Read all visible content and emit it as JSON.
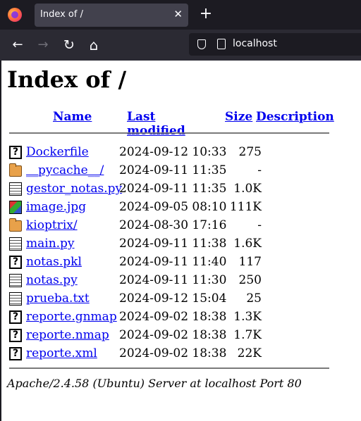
{
  "browser": {
    "tab_title": "Index of /",
    "tab_close": "✕",
    "new_tab": "+",
    "url": "localhost",
    "back": "←",
    "forward": "→",
    "reload": "↻",
    "home": "⌂"
  },
  "page": {
    "title": "Index of /",
    "columns": {
      "name": "Name",
      "modified": "Last modified",
      "size": "Size",
      "description": "Description"
    },
    "rows": [
      {
        "icon": "unknown",
        "name": "Dockerfile",
        "modified": "2024-09-12 10:33",
        "size": "275"
      },
      {
        "icon": "folder",
        "name": "__pycache__/",
        "modified": "2024-09-11 11:35",
        "size": "-"
      },
      {
        "icon": "text",
        "name": "gestor_notas.py",
        "modified": "2024-09-11 11:35",
        "size": "1.0K"
      },
      {
        "icon": "image",
        "name": "image.jpg",
        "modified": "2024-09-05 08:10",
        "size": "111K"
      },
      {
        "icon": "folder",
        "name": "kioptrix/",
        "modified": "2024-08-30 17:16",
        "size": "-"
      },
      {
        "icon": "text",
        "name": "main.py",
        "modified": "2024-09-11 11:38",
        "size": "1.6K"
      },
      {
        "icon": "unknown",
        "name": "notas.pkl",
        "modified": "2024-09-11 11:40",
        "size": "117"
      },
      {
        "icon": "text",
        "name": "notas.py",
        "modified": "2024-09-11 11:30",
        "size": "250"
      },
      {
        "icon": "text",
        "name": "prueba.txt",
        "modified": "2024-09-12 15:04",
        "size": "25"
      },
      {
        "icon": "unknown",
        "name": "reporte.gnmap",
        "modified": "2024-09-02 18:38",
        "size": "1.3K"
      },
      {
        "icon": "unknown",
        "name": "reporte.nmap",
        "modified": "2024-09-02 18:38",
        "size": "1.7K"
      },
      {
        "icon": "unknown",
        "name": "reporte.xml",
        "modified": "2024-09-02 18:38",
        "size": "22K"
      }
    ],
    "footer": "Apache/2.4.58 (Ubuntu) Server at localhost Port 80"
  }
}
